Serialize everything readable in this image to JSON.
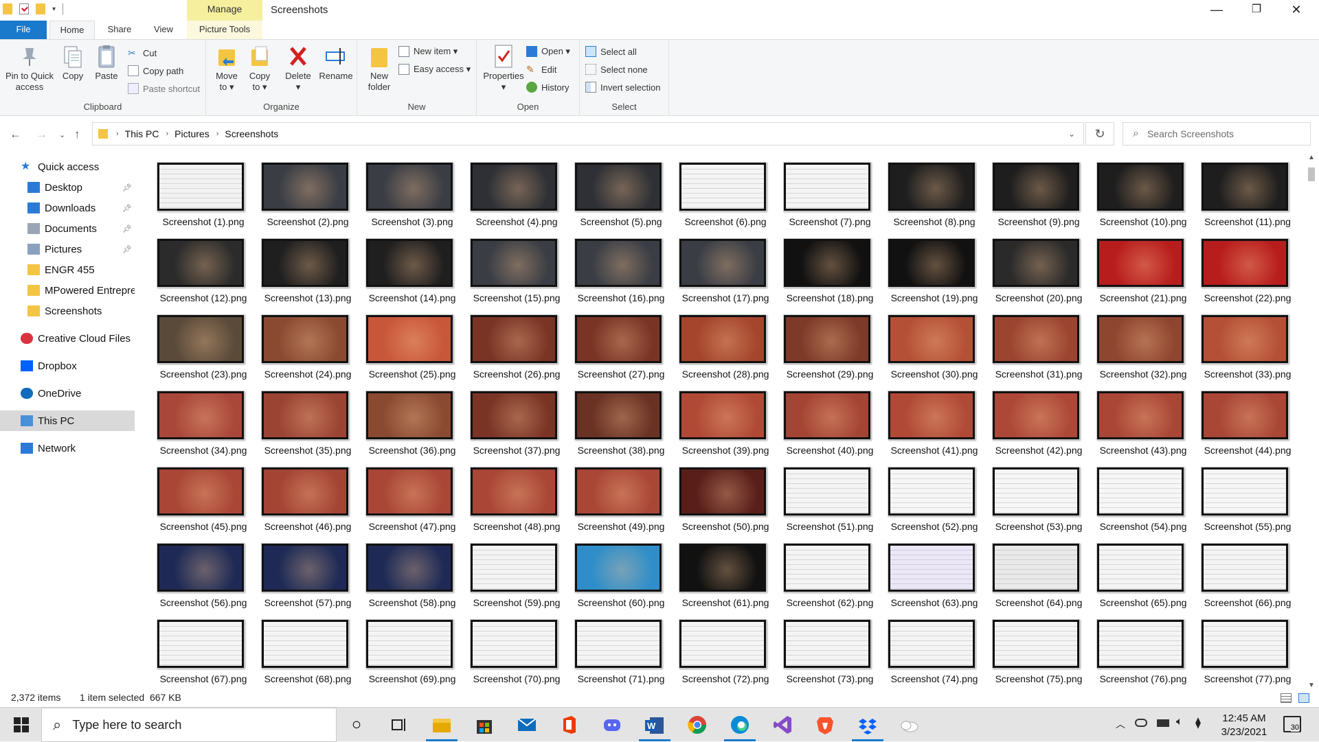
{
  "window": {
    "title": "Screenshots",
    "context_tab": "Manage",
    "controls": {
      "minimize": "—",
      "maximize": "❐",
      "close": "✕"
    }
  },
  "ribbon_tabs": [
    "File",
    "Home",
    "Share",
    "View",
    "Picture Tools"
  ],
  "ribbon": {
    "clipboard": {
      "label": "Clipboard",
      "pin": [
        "Pin to Quick",
        "access"
      ],
      "copy": "Copy",
      "paste": "Paste",
      "cut": "Cut",
      "copy_path": "Copy path",
      "paste_shortcut": "Paste shortcut"
    },
    "organize": {
      "label": "Organize",
      "move_to": [
        "Move",
        "to ▾"
      ],
      "copy_to": [
        "Copy",
        "to ▾"
      ],
      "delete": [
        "Delete",
        "▾"
      ],
      "rename": "Rename"
    },
    "new": {
      "label": "New",
      "new_folder": [
        "New",
        "folder"
      ],
      "new_item": "New item ▾",
      "easy_access": "Easy access ▾"
    },
    "open": {
      "label": "Open",
      "properties": [
        "Properties",
        "▾"
      ],
      "open": "Open ▾",
      "edit": "Edit",
      "history": "History"
    },
    "select": {
      "label": "Select",
      "select_all": "Select all",
      "select_none": "Select none",
      "invert": "Invert selection"
    }
  },
  "address": {
    "crumbs": [
      "This PC",
      "Pictures",
      "Screenshots"
    ],
    "search_placeholder": "Search Screenshots"
  },
  "nav": [
    {
      "label": "Quick access",
      "icon": "star-icon",
      "pinned": false,
      "indent": 0
    },
    {
      "label": "Desktop",
      "icon": "desktop-icon",
      "pinned": true,
      "indent": 1
    },
    {
      "label": "Downloads",
      "icon": "download-icon",
      "pinned": true,
      "indent": 1
    },
    {
      "label": "Documents",
      "icon": "document-icon",
      "pinned": true,
      "indent": 1
    },
    {
      "label": "Pictures",
      "icon": "pictures-icon",
      "pinned": true,
      "indent": 1
    },
    {
      "label": "ENGR 455",
      "icon": "folder-icon",
      "pinned": false,
      "indent": 1
    },
    {
      "label": "MPowered Entrepre",
      "icon": "folder-icon",
      "pinned": false,
      "indent": 1
    },
    {
      "label": "Screenshots",
      "icon": "folder-icon",
      "pinned": false,
      "indent": 1
    },
    {
      "label": "Creative Cloud Files",
      "icon": "creative-cloud-icon",
      "pinned": false,
      "indent": 0
    },
    {
      "label": "Dropbox",
      "icon": "dropbox-icon",
      "pinned": false,
      "indent": 0
    },
    {
      "label": "OneDrive",
      "icon": "cloud-icon",
      "pinned": false,
      "indent": 0
    },
    {
      "label": "This PC",
      "icon": "computer-icon",
      "pinned": false,
      "indent": 0,
      "selected": true
    },
    {
      "label": "Network",
      "icon": "network-icon",
      "pinned": false,
      "indent": 0
    }
  ],
  "files": [
    "Screenshot (1).png",
    "Screenshot (2).png",
    "Screenshot (3).png",
    "Screenshot (4).png",
    "Screenshot (5).png",
    "Screenshot (6).png",
    "Screenshot (7).png",
    "Screenshot (8).png",
    "Screenshot (9).png",
    "Screenshot (10).png",
    "Screenshot (11).png",
    "Screenshot (12).png",
    "Screenshot (13).png",
    "Screenshot (14).png",
    "Screenshot (15).png",
    "Screenshot (16).png",
    "Screenshot (17).png",
    "Screenshot (18).png",
    "Screenshot (19).png",
    "Screenshot (20).png",
    "Screenshot (21).png",
    "Screenshot (22).png",
    "Screenshot (23).png",
    "Screenshot (24).png",
    "Screenshot (25).png",
    "Screenshot (26).png",
    "Screenshot (27).png",
    "Screenshot (28).png",
    "Screenshot (29).png",
    "Screenshot (30).png",
    "Screenshot (31).png",
    "Screenshot (32).png",
    "Screenshot (33).png",
    "Screenshot (34).png",
    "Screenshot (35).png",
    "Screenshot (36).png",
    "Screenshot (37).png",
    "Screenshot (38).png",
    "Screenshot (39).png",
    "Screenshot (40).png",
    "Screenshot (41).png",
    "Screenshot (42).png",
    "Screenshot (43).png",
    "Screenshot (44).png",
    "Screenshot (45).png",
    "Screenshot (46).png",
    "Screenshot (47).png",
    "Screenshot (48).png",
    "Screenshot (49).png",
    "Screenshot (50).png",
    "Screenshot (51).png",
    "Screenshot (52).png",
    "Screenshot (53).png",
    "Screenshot (54).png",
    "Screenshot (55).png",
    "Screenshot (56).png",
    "Screenshot (57).png",
    "Screenshot (58).png",
    "Screenshot (59).png",
    "Screenshot (60).png",
    "Screenshot (61).png",
    "Screenshot (62).png",
    "Screenshot (63).png",
    "Screenshot (64).png",
    "Screenshot (65).png",
    "Screenshot (66).png",
    "Screenshot (67).png",
    "Screenshot (68).png",
    "Screenshot (69).png",
    "Screenshot (70).png",
    "Screenshot (71).png",
    "Screenshot (72).png",
    "Screenshot (73).png",
    "Screenshot (74).png",
    "Screenshot (75).png",
    "Screenshot (76).png",
    "Screenshot (77).png"
  ],
  "thumb_colors": [
    "#f2f2f2",
    "#3a3d44",
    "#3a3d44",
    "#2e3035",
    "#2e3035",
    "#f4f4f4",
    "#f4f4f4",
    "#1e1e1e",
    "#1e1e1e",
    "#1e1e1e",
    "#1e1e1e",
    "#2b2b2b",
    "#1f1f1f",
    "#1f1f1f",
    "#3a3d44",
    "#3a3d44",
    "#3a3d44",
    "#111111",
    "#111111",
    "#2a2a2a",
    "#b81d1d",
    "#b81d1d",
    "#5a4a3a",
    "#8a4a32",
    "#c8573a",
    "#7a3426",
    "#7a3426",
    "#a4452c",
    "#7d3a29",
    "#b45036",
    "#9b4430",
    "#8f4630",
    "#b45036",
    "#a9473a",
    "#9b4434",
    "#8a4a32",
    "#7a3426",
    "#6a3224",
    "#b04a36",
    "#a44434",
    "#b04a36",
    "#ad4838",
    "#a94636",
    "#a94636",
    "#a94636",
    "#a44434",
    "#a94636",
    "#a94636",
    "#a94636",
    "#5a1e1a",
    "#f4f4f4",
    "#f6f6f6",
    "#f6f6f6",
    "#f6f6f6",
    "#f6f6f6",
    "#1e2a55",
    "#1e2a55",
    "#1e2a55",
    "#f3f3f3",
    "#2f8ec9",
    "#111111",
    "#f4f4f4",
    "#ece7f7",
    "#e9e9e9",
    "#f4f4f4",
    "#f4f4f4",
    "#f4f4f4",
    "#f4f4f4",
    "#f4f4f4",
    "#f4f4f4",
    "#f4f4f4",
    "#f4f4f4",
    "#f4f4f4",
    "#f4f4f4",
    "#f4f4f4",
    "#f4f4f4",
    "#f4f4f4"
  ],
  "status": {
    "count": "2,372 items",
    "selection": "1 item selected  667 KB"
  },
  "taskbar": {
    "search_placeholder": "Type here to search",
    "time": "12:45 AM",
    "date": "3/23/2021",
    "notifications": "30"
  },
  "colors": {
    "accent": "#1979ca",
    "manage": "#f6ef9e"
  }
}
